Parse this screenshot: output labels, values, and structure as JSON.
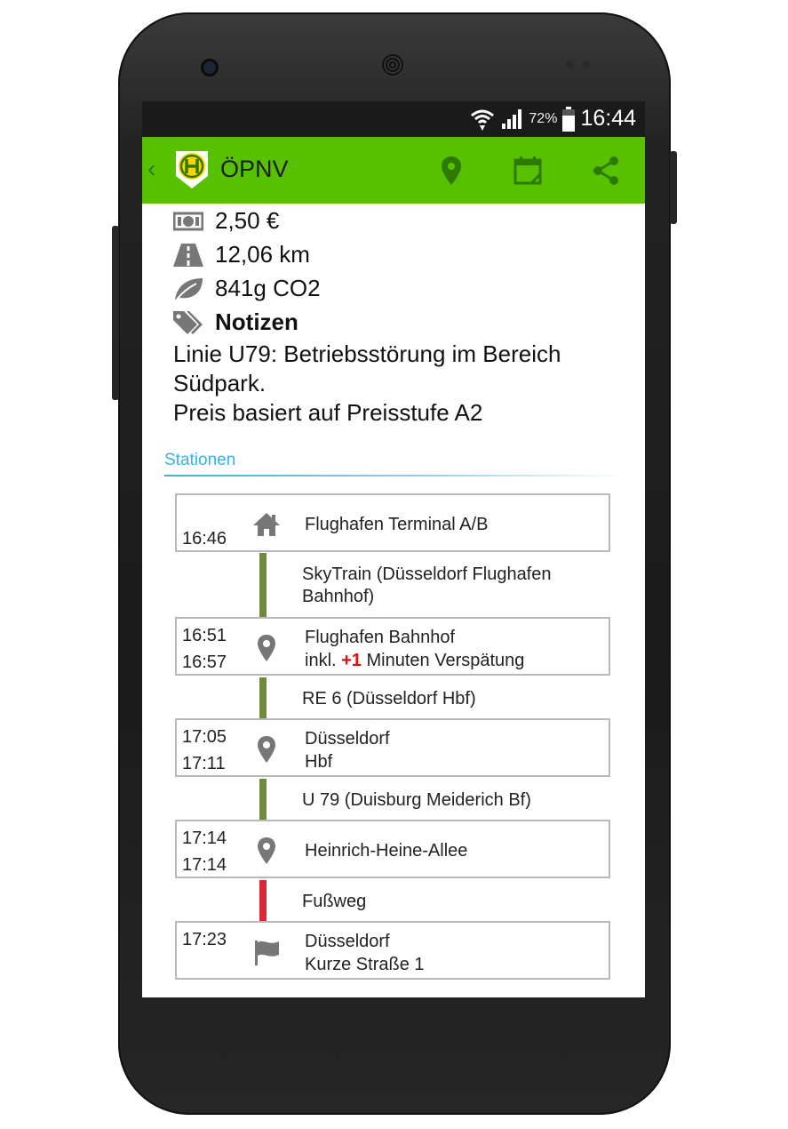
{
  "status_bar": {
    "battery_percent": "72%",
    "time": "16:44"
  },
  "action_bar": {
    "back_icon": "chevron-left-icon",
    "app_icon": "bus-stop-h-icon",
    "title": "ÖPNV",
    "actions": [
      "map-pin-icon",
      "calendar-icon",
      "share-icon"
    ],
    "color": "#57c100"
  },
  "summary": {
    "price": "2,50 €",
    "distance": "12,06 km",
    "co2": "841g CO2",
    "notes_heading": "Notizen",
    "notes_lines": [
      "Linie U79: Betriebsstörung im Bereich",
      "Südpark.",
      "Preis basiert auf Preisstufe A2"
    ]
  },
  "stations": {
    "section_title": "Stationen",
    "stops": [
      {
        "times": [
          "",
          "16:46"
        ],
        "icon": "home-icon",
        "name_lines": [
          "Flughafen Terminal A/B"
        ]
      },
      {
        "times": [
          "16:51",
          "16:57"
        ],
        "icon": "map-marker-icon",
        "name_lines": [
          "Flughafen Bahnhof"
        ],
        "delay": {
          "prefix": "inkl. ",
          "value": "+1",
          "suffix": " Minuten Verspätung"
        }
      },
      {
        "times": [
          "17:05",
          "17:11"
        ],
        "icon": "map-marker-icon",
        "name_lines": [
          "Düsseldorf",
          "Hbf"
        ]
      },
      {
        "times": [
          "17:14",
          "17:14"
        ],
        "icon": "map-marker-icon",
        "name_lines": [
          "Heinrich-Heine-Allee"
        ]
      },
      {
        "times": [
          "17:23",
          ""
        ],
        "icon": "flag-icon",
        "name_lines": [
          "Düsseldorf",
          "Kurze Straße 1"
        ]
      }
    ],
    "legs": [
      {
        "label_lines": [
          "SkyTrain (Düsseldorf Flughafen",
          "Bahnhof)"
        ],
        "color": "#6e8b3d"
      },
      {
        "label_lines": [
          "RE 6 (Düsseldorf Hbf)"
        ],
        "color": "#6e8b3d"
      },
      {
        "label_lines": [
          "U 79 (Duisburg Meiderich Bf)"
        ],
        "color": "#6e8b3d"
      },
      {
        "label_lines": [
          "Fußweg"
        ],
        "color": "#d9263a"
      }
    ]
  }
}
